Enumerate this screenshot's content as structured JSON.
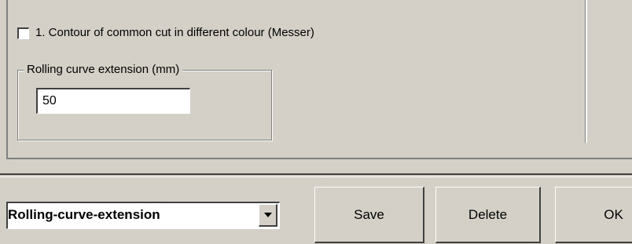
{
  "options": {
    "contour_checkbox_label": "1. Contour of common cut in different colour (Messer)",
    "contour_checked": false
  },
  "rolling_curve_group": {
    "title": "Rolling curve extension (mm)",
    "value": "50"
  },
  "footer": {
    "preset_selected": "Rolling-curve-extension",
    "save_label": "Save",
    "delete_label": "Delete",
    "ok_label": "OK"
  },
  "icons": {
    "dropdown_arrow": "chevron-down-icon"
  }
}
